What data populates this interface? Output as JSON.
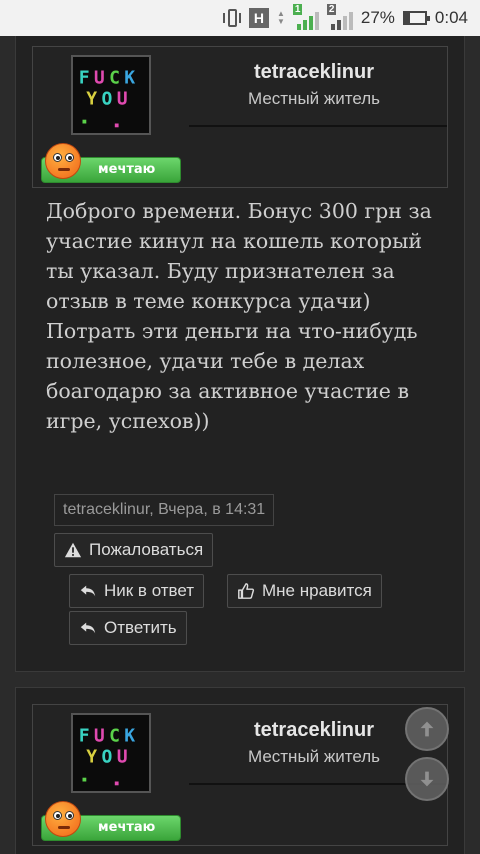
{
  "status_bar": {
    "network_type": "H",
    "sim1_label": "1",
    "sim2_label": "2",
    "battery_percent": "27%",
    "battery_level": 0.27,
    "time": "0:04"
  },
  "posts": [
    {
      "author": {
        "name": "tetraceklinur",
        "title": "Местный житель",
        "rank": "мечтаю",
        "avatar_text": [
          "FUCK",
          "YOU"
        ]
      },
      "text": "Доброго времени. Бонус 300 грн за участие кинул на кошель который ты указал. Буду признателен за отзыв в теме конкурса удачи) Потрать эти деньги на что-нибудь полезное, удачи тебе в делах боагодарю за активное участие в игре, успехов))",
      "meta": "tetraceklinur, Вчера, в 14:31",
      "actions": {
        "report": "Пожаловаться",
        "nick_reply": "Ник в ответ",
        "like": "Мне нравится",
        "reply": "Ответить"
      }
    },
    {
      "author": {
        "name": "tetraceklinur",
        "title": "Местный житель",
        "rank": "мечтаю",
        "avatar_text": [
          "FUCK",
          "YOU"
        ]
      }
    }
  ],
  "icons": {
    "scroll_up": "arrow-up-icon",
    "scroll_down": "arrow-down-icon"
  }
}
